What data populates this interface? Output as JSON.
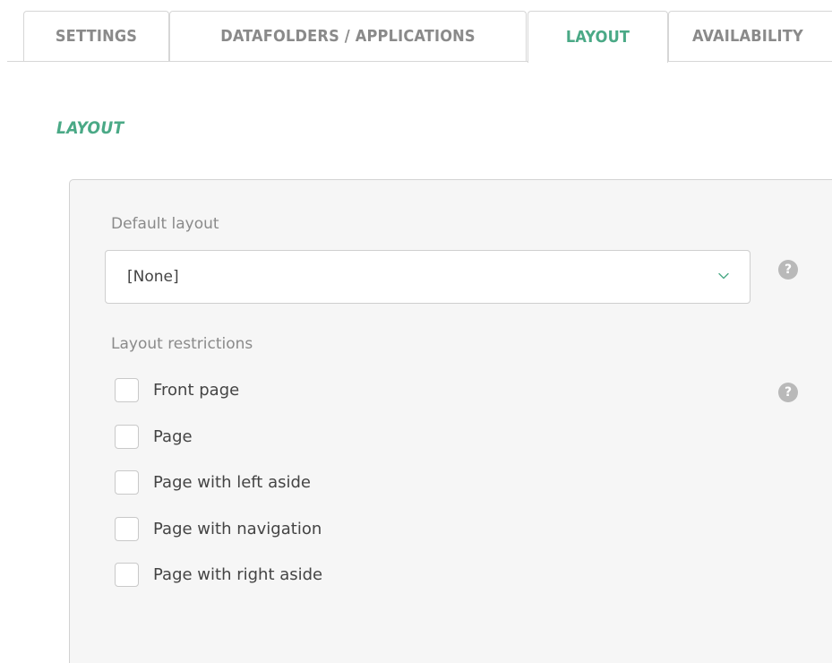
{
  "tabs": [
    {
      "label": "SETTINGS",
      "active": false
    },
    {
      "label": "DATAFOLDERS / APPLICATIONS",
      "active": false
    },
    {
      "label": "LAYOUT",
      "active": true
    },
    {
      "label": "AVAILABILITY",
      "active": false
    }
  ],
  "section": {
    "title": "LAYOUT"
  },
  "default_layout": {
    "label": "Default layout",
    "value": "[None]",
    "help_icon": "question-circle-icon",
    "help_glyph": "?"
  },
  "restrictions": {
    "label": "Layout restrictions",
    "help_icon": "question-circle-icon",
    "help_glyph": "?",
    "options": [
      {
        "label": "Front page",
        "checked": false
      },
      {
        "label": "Page",
        "checked": false
      },
      {
        "label": "Page with left aside",
        "checked": false
      },
      {
        "label": "Page with navigation",
        "checked": false
      },
      {
        "label": "Page with right aside",
        "checked": false
      }
    ]
  },
  "colors": {
    "accent": "#4aa986",
    "tab_inactive": "#8a8a8a",
    "panel_bg": "#f6f6f6",
    "help_bg": "#b9b9b9"
  }
}
